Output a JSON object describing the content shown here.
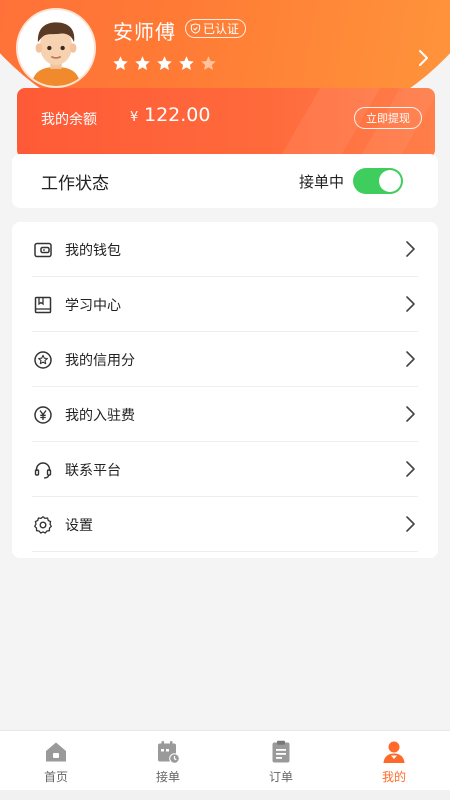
{
  "profile": {
    "name": "安师傅",
    "verified_label": "已认证",
    "rating": 4,
    "rating_max": 5
  },
  "balance": {
    "label": "我的余额",
    "currency": "¥",
    "amount": "122.00",
    "withdraw_label": "立即提现"
  },
  "work_status": {
    "title": "工作状态",
    "status_text": "接单中",
    "enabled": true
  },
  "menu": {
    "items": [
      {
        "label": "我的钱包",
        "icon": "wallet-icon"
      },
      {
        "label": "学习中心",
        "icon": "book-icon"
      },
      {
        "label": "我的信用分",
        "icon": "star-badge-icon"
      },
      {
        "label": "我的入驻费",
        "icon": "yen-icon"
      },
      {
        "label": "联系平台",
        "icon": "headset-icon"
      },
      {
        "label": "设置",
        "icon": "gear-icon"
      }
    ]
  },
  "nav": {
    "items": [
      {
        "label": "首页",
        "icon": "home-icon"
      },
      {
        "label": "接单",
        "icon": "calendar-clock-icon"
      },
      {
        "label": "订单",
        "icon": "clipboard-icon"
      },
      {
        "label": "我的",
        "icon": "user-icon",
        "active": true
      }
    ]
  },
  "colors": {
    "accent": "#ff6a2b",
    "header_start": "#ff6b3a",
    "header_end": "#ff9a3c",
    "toggle_on": "#3fce5e",
    "star_filled": "#ffffff",
    "star_empty": "#ffc29a"
  }
}
